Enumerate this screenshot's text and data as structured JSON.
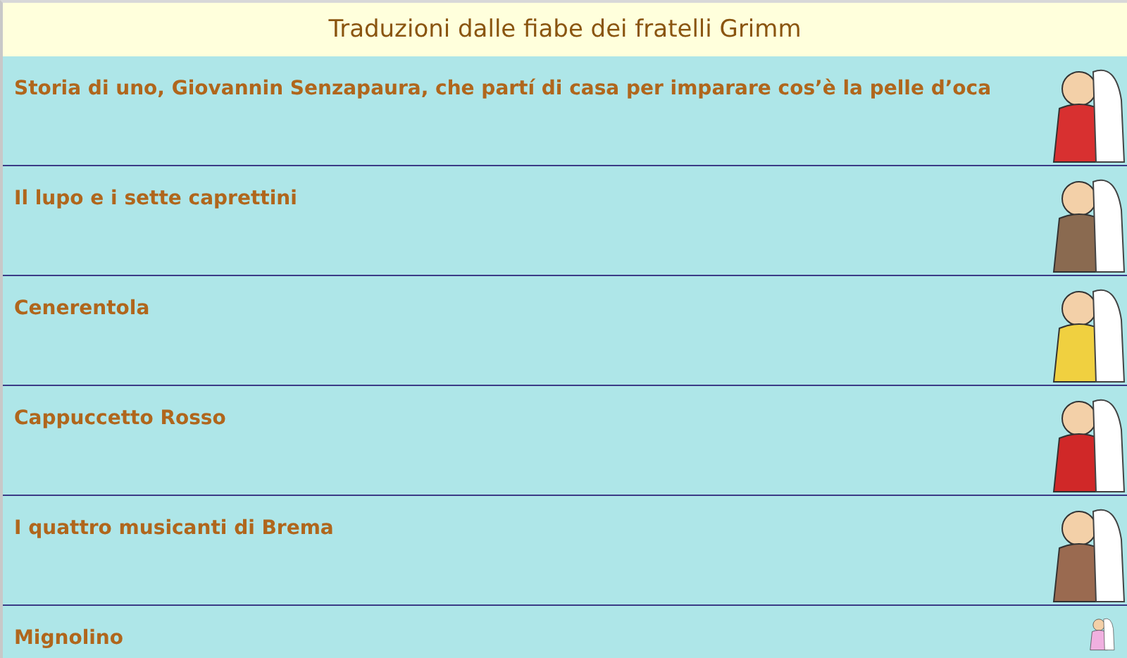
{
  "header": {
    "title": "Traduzioni dalle fiabe dei fratelli Grimm"
  },
  "stories": [
    {
      "title": "Storia di uno, Giovannin Senzapaura, che partí di casa per imparare cos’è la pelle d’oca"
    },
    {
      "title": "Il lupo e i sette caprettini"
    },
    {
      "title": "Cenerentola"
    },
    {
      "title": "Cappuccetto Rosso"
    },
    {
      "title": "I quattro musicanti di Brema"
    },
    {
      "title": "Mignolino"
    }
  ]
}
